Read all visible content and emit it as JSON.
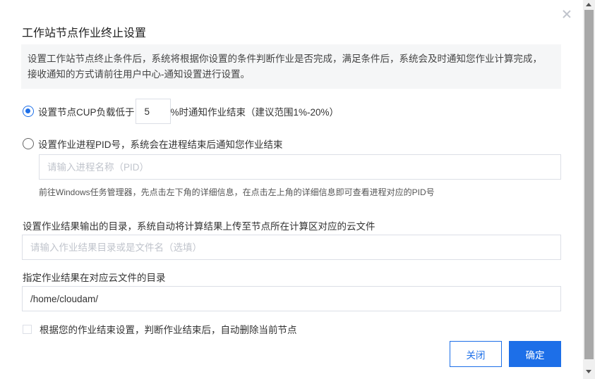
{
  "dialog": {
    "title": "工作站节点作业终止设置",
    "notice": "设置工作站节点终止条件后，系统将根据你设置的条件判断作业是否完成，满足条件后，系统会及时通知您作业计算完成，接收通知的方式请前往用户中心-通知设置进行设置。"
  },
  "option_cpu": {
    "prefix": "设置节点CUP负载低于",
    "value": "5",
    "suffix": "%时通知作业结束（建议范围1%-20%）",
    "checked": true
  },
  "option_pid": {
    "label": "设置作业进程PID号，系统会在进程结束后通知您作业结束",
    "placeholder": "请输入进程名称（PID）",
    "hint": "前往Windows任务管理器，先点击左下角的详细信息，在点击左上角的详细信息即可查看进程对应的PID号",
    "checked": false
  },
  "output_dir": {
    "label": "设置作业结果输出的目录，系统自动将计算结果上传至节点所在计算区对应的云文件",
    "placeholder": "请输入作业结果目录或是文件名（选填）"
  },
  "cloud_dir": {
    "label": "指定作业结果在对应云文件的目录",
    "value": "/home/cloudam/"
  },
  "auto_delete": {
    "label": "根据您的作业结束设置，判断作业结束后，自动删除当前节点",
    "checked": false
  },
  "buttons": {
    "cancel": "关闭",
    "confirm": "确定"
  },
  "colors": {
    "primary": "#1d6fe8",
    "notice_bg": "#f5f6f7"
  }
}
